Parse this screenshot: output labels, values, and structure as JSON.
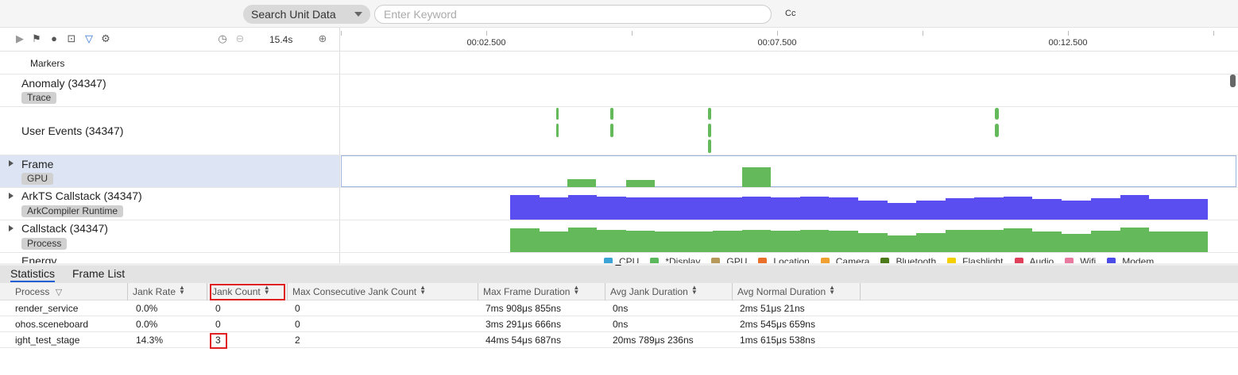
{
  "search": {
    "type_label": "Search Unit Data",
    "placeholder": "Enter Keyword",
    "case_label": "Cc"
  },
  "toolbar": {
    "zoom_value": "15.4s"
  },
  "ruler": {
    "labels": [
      "00:02.500",
      "00:07.500",
      "00:12.500"
    ]
  },
  "tracks": {
    "markers": "Markers",
    "anomaly": {
      "name": "Anomaly (34347)",
      "tag": "Trace"
    },
    "user_events": {
      "name": "User Events (34347)"
    },
    "frame": {
      "name": "Frame",
      "tag": "GPU"
    },
    "arkts": {
      "name": "ArkTS Callstack (34347)",
      "tag": "ArkCompiler Runtime"
    },
    "callstack": {
      "name": "Callstack (34347)",
      "tag": "Process"
    },
    "energy": {
      "name": "Energy"
    }
  },
  "legend": [
    {
      "label": "CPU",
      "color": "#3ba3d6"
    },
    {
      "label": "*Display",
      "color": "#5cb85c"
    },
    {
      "label": "GPU",
      "color": "#b5985a"
    },
    {
      "label": "Location",
      "color": "#e8702a"
    },
    {
      "label": "Camera",
      "color": "#f0a030"
    },
    {
      "label": "Bluetooth",
      "color": "#4c7a1a"
    },
    {
      "label": "Flashlight",
      "color": "#f5d000"
    },
    {
      "label": "Audio",
      "color": "#e0405a"
    },
    {
      "label": "Wifi",
      "color": "#e87aa0"
    },
    {
      "label": "Modem",
      "color": "#4b4be8"
    }
  ],
  "colors": {
    "green_track": "#64ba5a",
    "purple_track": "#5b4ef0",
    "highlight": "#e02020"
  },
  "bottom_tabs": {
    "statistics": "Statistics",
    "frame_list": "Frame List"
  },
  "table": {
    "headers": [
      "Process",
      "Jank Rate",
      "Jank Count",
      "Max Consecutive Jank Count",
      "Max Frame Duration",
      "Avg Jank Duration",
      "Avg Normal Duration"
    ],
    "rows": [
      [
        "render_service",
        "0.0%",
        "0",
        "0",
        "7ms 908μs 855ns",
        "0ns",
        "2ms 51μs 21ns"
      ],
      [
        "ohos.sceneboard",
        "0.0%",
        "0",
        "0",
        "3ms 291μs 666ns",
        "0ns",
        "2ms 545μs 659ns"
      ],
      [
        "ight_test_stage",
        "14.3%",
        "3",
        "2",
        "44ms 54μs 687ns",
        "20ms 789μs 236ns",
        "1ms 615μs 538ns"
      ]
    ]
  }
}
